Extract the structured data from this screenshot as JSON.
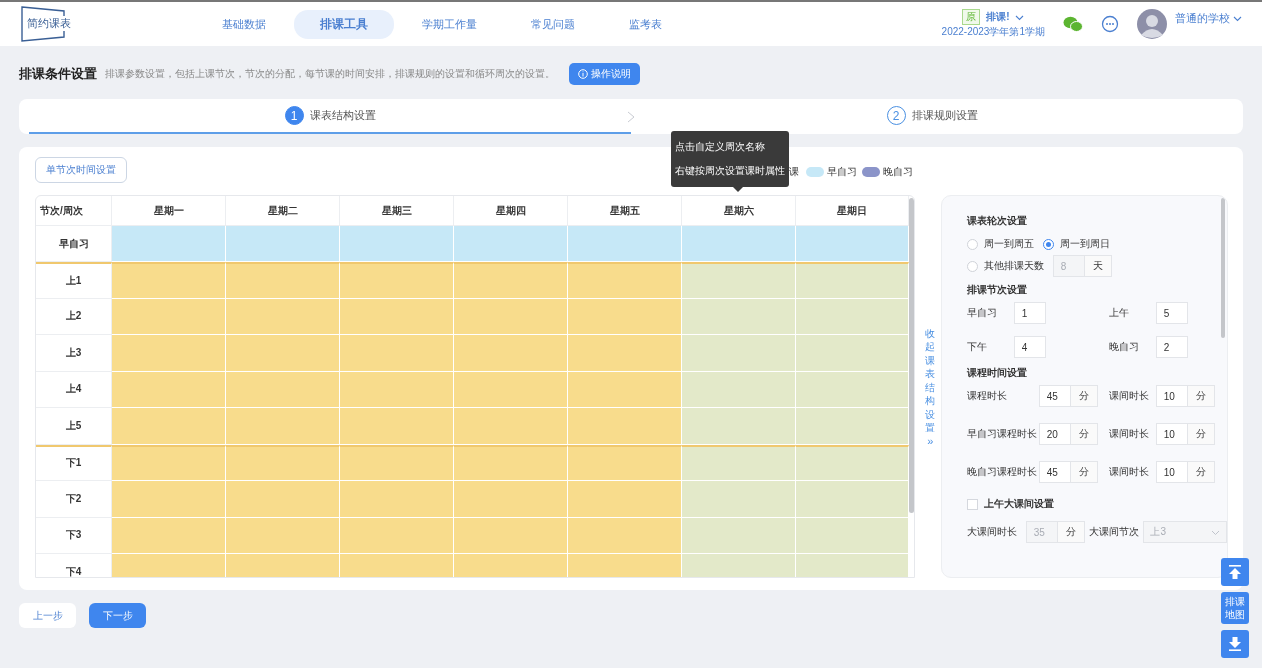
{
  "header": {
    "logo": "简约课表",
    "nav": [
      {
        "label": "基础数据",
        "selected": false
      },
      {
        "label": "排课工具",
        "selected": true
      },
      {
        "label": "学期工作量",
        "selected": false
      },
      {
        "label": "常见问题",
        "selected": false
      },
      {
        "label": "监考表",
        "selected": false
      }
    ],
    "badge": "原",
    "schedule_name": "排课!",
    "term": "2022-2023学年第1学期",
    "school": "普通的学校"
  },
  "page": {
    "title": "排课条件设置",
    "description": "排课参数设置，包括上课节次，节次的分配，每节课的时间安排，排课规则的设置和循环周次的设置。",
    "help_button": "操作说明"
  },
  "steps": [
    {
      "number": "1",
      "label": "课表结构设置",
      "selected": true
    },
    {
      "number": "2",
      "label": "排课规则设置",
      "selected": false
    }
  ],
  "toolbar": {
    "button": "单节次时间设置"
  },
  "tooltip": [
    "点击自定义周次名称",
    "右键按周次设置课时属性"
  ],
  "legend": [
    {
      "label": "课"
    },
    {
      "label": "早自习",
      "color": "#c6e8f7"
    },
    {
      "label": "晚自习",
      "color": "#8b94c9"
    }
  ],
  "table": {
    "corner": "节次/周次",
    "columns": [
      {
        "label": "星期一",
        "weekend": false
      },
      {
        "label": "星期二",
        "weekend": false
      },
      {
        "label": "星期三",
        "weekend": false
      },
      {
        "label": "星期四",
        "weekend": false
      },
      {
        "label": "星期五",
        "weekend": false
      },
      {
        "label": "星期六",
        "weekend": true
      },
      {
        "label": "星期日",
        "weekend": true
      }
    ],
    "rows": [
      {
        "label": "早自习",
        "kind": "early"
      },
      {
        "label": "上1",
        "kind": "morning"
      },
      {
        "label": "上2",
        "kind": "morning"
      },
      {
        "label": "上3",
        "kind": "morning"
      },
      {
        "label": "上4",
        "kind": "morning"
      },
      {
        "label": "上5",
        "kind": "morning"
      },
      {
        "label": "下1",
        "kind": "afternoon"
      },
      {
        "label": "下2",
        "kind": "afternoon"
      },
      {
        "label": "下3",
        "kind": "afternoon"
      },
      {
        "label": "下4",
        "kind": "afternoon"
      }
    ]
  },
  "collapse": {
    "label": "收起课表结构设置",
    "icon": "»"
  },
  "settings": {
    "rotation": {
      "title": "课表轮次设置",
      "options": [
        {
          "label": "周一到周五",
          "selected": false
        },
        {
          "label": "周一到周日",
          "selected": true
        },
        {
          "label": "其他排课天数",
          "selected": false
        }
      ],
      "other_days": {
        "value": "8",
        "unit": "天",
        "disabled": true
      }
    },
    "periods": {
      "title": "排课节次设置",
      "fields": [
        {
          "label": "早自习",
          "value": "1"
        },
        {
          "label": "上午",
          "value": "5"
        },
        {
          "label": "下午",
          "value": "4"
        },
        {
          "label": "晚自习",
          "value": "2"
        }
      ]
    },
    "times": {
      "title": "课程时间设置",
      "fields": [
        {
          "label": "课程时长",
          "value": "45",
          "unit": "分"
        },
        {
          "label": "课间时长",
          "value": "10",
          "unit": "分"
        },
        {
          "label": "早自习课程时长",
          "value": "20",
          "unit": "分"
        },
        {
          "label": "课间时长",
          "value": "10",
          "unit": "分"
        },
        {
          "label": "晚自习课程时长",
          "value": "45",
          "unit": "分"
        },
        {
          "label": "课间时长",
          "value": "10",
          "unit": "分"
        }
      ]
    },
    "big_break": {
      "label": "上午大课间设置",
      "checked": false,
      "duration": {
        "label": "大课间时长",
        "value": "35",
        "unit": "分",
        "disabled": true
      },
      "period": {
        "label": "大课间节次",
        "value": "上3",
        "disabled": true
      }
    }
  },
  "side_buttons": {
    "map": "排课地图"
  },
  "footer": {
    "prev": "上一步",
    "next": "下一步"
  }
}
